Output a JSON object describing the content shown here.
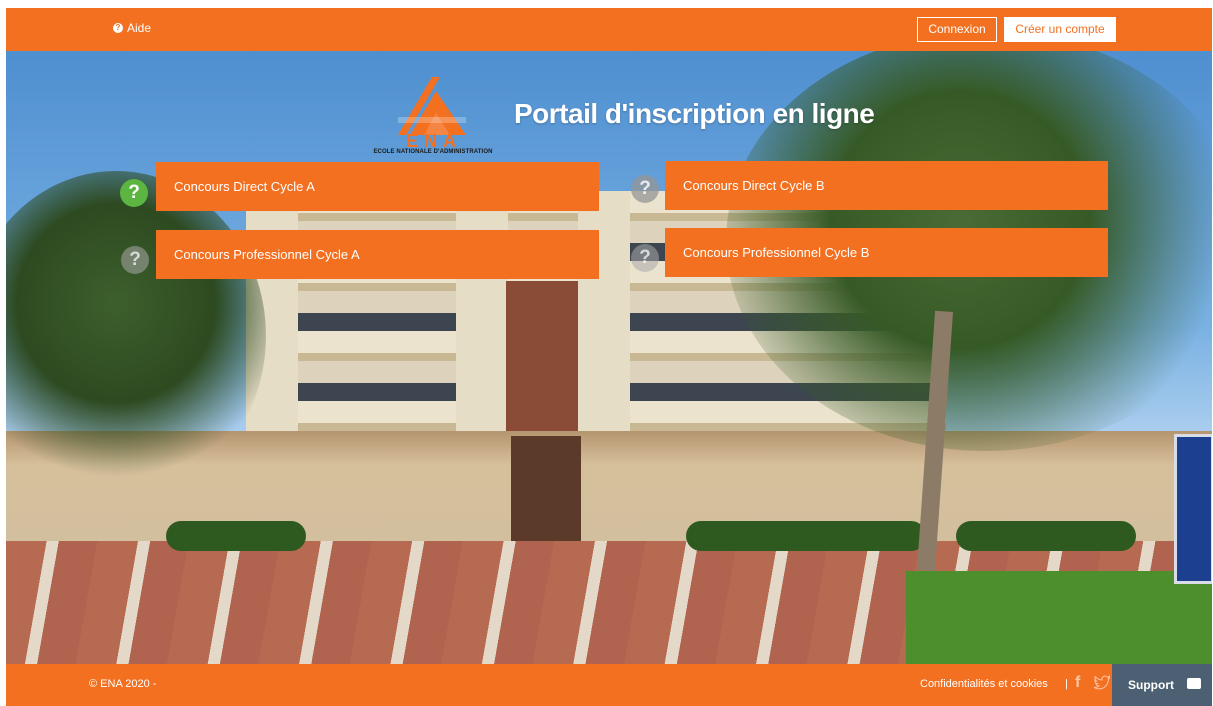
{
  "header": {
    "help_label": "Aide",
    "login_label": "Connexion",
    "signup_label": "Créer un compte"
  },
  "hero": {
    "logo_text": "ENA",
    "logo_caption": "ECOLE NATIONALE D'ADMINISTRATION",
    "title": "Portail d'inscription en ligne"
  },
  "concours": [
    {
      "label": "Concours Direct Cycle A",
      "icon": "question-circle-icon",
      "icon_color": "#5cb541"
    },
    {
      "label": "Concours Direct Cycle B",
      "icon": "question-circle-icon",
      "icon_color": "#969696"
    },
    {
      "label": "Concours Professionnel Cycle A",
      "icon": "question-circle-icon",
      "icon_color": "#aaaaaa"
    },
    {
      "label": "Concours Professionnel Cycle B",
      "icon": "question-circle-icon",
      "icon_color": "#aaaaaa"
    }
  ],
  "footer": {
    "copyright": "© ENA 2020 -",
    "privacy_link": "Confidentialités et cookies",
    "separator": "|",
    "support_label": "Support"
  },
  "colors": {
    "brand_orange": "#f37021",
    "support_bg": "#4c5f73",
    "help_green": "#5cb541"
  }
}
